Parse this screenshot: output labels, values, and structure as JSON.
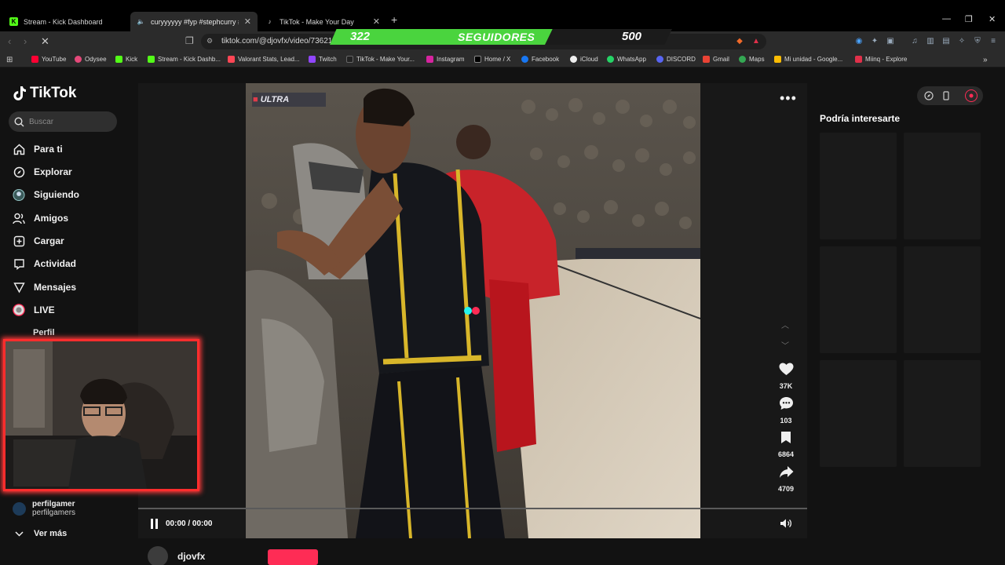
{
  "browser": {
    "tabs": [
      {
        "title": "Stream - Kick Dashboard",
        "icon": "kick-icon"
      },
      {
        "title": "curyyyyyy #fyp #stephcurry #nb",
        "icon": "sound-icon"
      },
      {
        "title": "TikTok - Make Your Day",
        "icon": "tiktok-icon"
      }
    ],
    "url": "tiktok.com/@djovfx/video/73621",
    "bookmarks": [
      "YouTube",
      "Odysee",
      "Kick",
      "Stream - Kick Dashb...",
      "Valorant Stats, Lead...",
      "Twitch",
      "TikTok - Make Your...",
      "Instagram",
      "Home / X",
      "Facebook",
      "iCloud",
      "WhatsApp",
      "DISCORD",
      "Gmail",
      "Maps",
      "Mi unidad - Google...",
      "Miinq - Explore"
    ]
  },
  "overlay": {
    "count": "322",
    "label": "SEGUIDORES",
    "goal": "500"
  },
  "tiktok": {
    "logo": "TikTok",
    "search_placeholder": "Buscar",
    "nav": [
      "Para ti",
      "Explorar",
      "Siguiendo",
      "Amigos",
      "Cargar",
      "Actividad",
      "Mensajes",
      "LIVE",
      "Perfil"
    ],
    "following_user": {
      "name": "perfilgamer",
      "handle": "perfilgamers"
    },
    "see_more": "Ver más",
    "video": {
      "brand": "ULTRA",
      "likes": "37K",
      "comments": "103",
      "saves": "6864",
      "shares": "4709",
      "time": "00:00 / 00:00",
      "author": "djovfx"
    },
    "suggestions_title": "Podría interesarte"
  }
}
